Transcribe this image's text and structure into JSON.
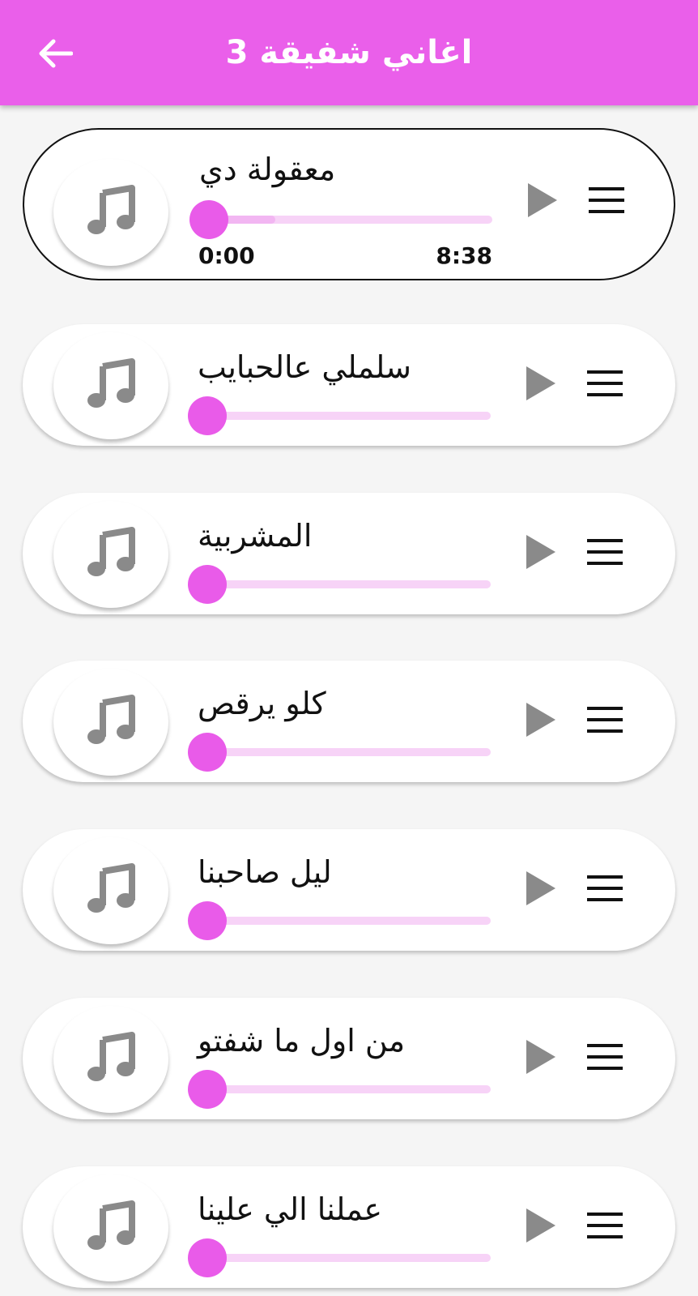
{
  "appbar": {
    "title": "اغاني شفيقة 3",
    "back_icon": "arrow-back-icon",
    "background": "#ea5fea"
  },
  "songs": [
    {
      "title": "معقولة دي",
      "active": true,
      "current_time": "0:00",
      "duration": "8:38",
      "progress": 0,
      "buffered": 0.26
    },
    {
      "title": "سلملي عالحبايب",
      "active": false,
      "progress": 0
    },
    {
      "title": "المشربية",
      "active": false,
      "progress": 0
    },
    {
      "title": "كلو يرقص",
      "active": false,
      "progress": 0
    },
    {
      "title": "ليل صاحبنا",
      "active": false,
      "progress": 0
    },
    {
      "title": "من اول ما شفتو",
      "active": false,
      "progress": 0
    },
    {
      "title": "عملنا الي علينا",
      "active": false,
      "progress": 0
    }
  ],
  "icons": {
    "thumb": "music-note-icon",
    "play": "play-icon",
    "menu": "menu-icon"
  },
  "colors": {
    "accent": "#e95be9",
    "track": "#f7d3f7",
    "buffer": "#f2b6f2",
    "icon_gray": "#8a8a8a"
  }
}
